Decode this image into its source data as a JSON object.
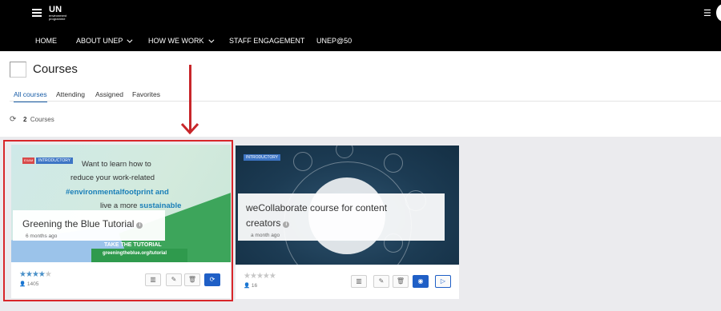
{
  "header": {
    "logo_line1": "UN",
    "logo_line2": "environment programme",
    "nav": [
      "HOME",
      "ABOUT UNEP",
      "HOW WE WORK",
      "STAFF ENGAGEMENT",
      "UNEP@50"
    ]
  },
  "page": {
    "title": "Courses",
    "tabs": [
      "All courses",
      "Attending",
      "Assigned",
      "Favorites"
    ],
    "count_number": "2",
    "count_label": "Courses"
  },
  "cards": [
    {
      "badge_exam": "EXAM",
      "badge_type": "INTRODUCTORY",
      "img_lines": [
        "Want to learn how to",
        "reduce your work-related",
        "#environmentalfootprint and",
        "live a more"
      ],
      "img_sustainable": "sustainable",
      "img_take": "TAKE THE TUTORIAL",
      "img_url": "greeningtheblue.org/tutorial",
      "title": "Greening the Blue Tutorial",
      "time": "6 months ago",
      "rating": 4,
      "enrolled": "1405"
    },
    {
      "badge_type": "INTRODUCTORY",
      "title_line1": "weCollaborate course for content",
      "title_line2": "creators",
      "time": "a month ago",
      "rating": 0,
      "enrolled": "16"
    }
  ],
  "colors": {
    "accent": "#1f5fc6",
    "highlight": "#d8262a",
    "topbar": "#000000"
  }
}
